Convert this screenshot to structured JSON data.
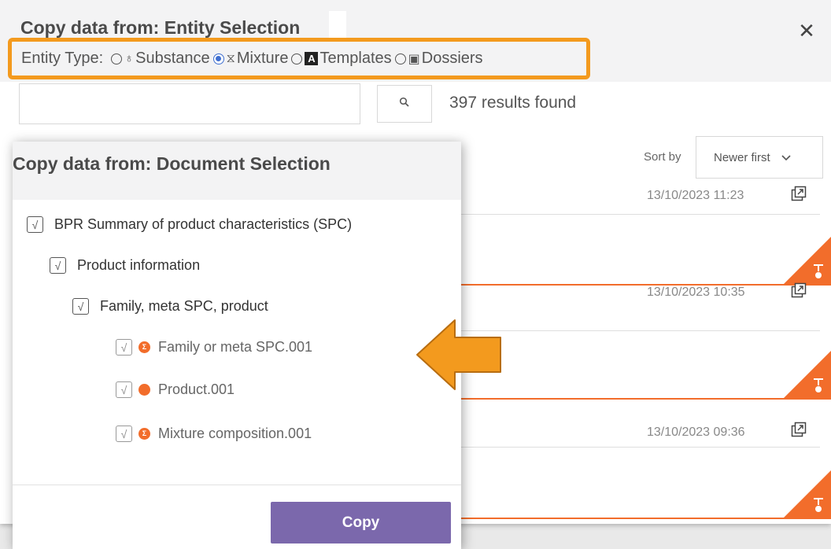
{
  "background_dialog": {
    "title": "Copy data from: Entity Selection",
    "close_glyph": "✕",
    "entity_type": {
      "label": "Entity Type:",
      "selected": "Mixture",
      "options": [
        {
          "label": "Substance",
          "icon": "flask-icon",
          "glyph": "♁"
        },
        {
          "label": "Mixture",
          "icon": "mixture-icon",
          "glyph": "⧖"
        },
        {
          "label": "Templates",
          "icon": "template-icon",
          "glyph": "A"
        },
        {
          "label": "Dossiers",
          "icon": "dossier-icon",
          "glyph": "▣"
        }
      ]
    },
    "search": {
      "placeholder": "",
      "value": "",
      "button_icon": "🔍"
    },
    "results_text": "397 results found",
    "sort": {
      "label": "Sort by",
      "value": "Newer first"
    },
    "rows": [
      {
        "date": "13/10/2023 11:23"
      },
      {
        "date": "13/10/2023 10:35"
      },
      {
        "date": "13/10/2023 09:36"
      }
    ]
  },
  "document_dialog": {
    "title": "Copy data from: Document Selection",
    "tree": [
      {
        "label": "BPR Summary of product characteristics (SPC)",
        "level": 0,
        "checked": true
      },
      {
        "label": "Product information",
        "level": 1,
        "checked": true
      },
      {
        "label": "Family, meta SPC, product",
        "level": 2,
        "checked": true
      },
      {
        "label": "Family or meta SPC.001",
        "level": 3,
        "checked": true,
        "icon": "sigma-icon"
      },
      {
        "label": "Product.001",
        "level": 3,
        "checked": true,
        "icon": "dot-icon"
      },
      {
        "label": "Mixture composition.001",
        "level": 3,
        "checked": true,
        "icon": "sigma-icon"
      }
    ],
    "check_glyph": "√",
    "sigma_glyph": "Σ",
    "copy_label": "Copy"
  },
  "colors": {
    "highlight": "#f39a1e",
    "accent": "#f26d2b",
    "button": "#7b68ac",
    "radio_selected": "#3f6fd0"
  }
}
